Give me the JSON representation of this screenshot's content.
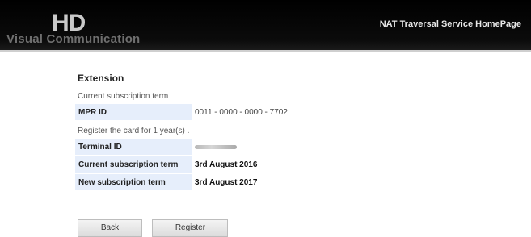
{
  "header": {
    "logo_mark": "HD",
    "logo_text": "Visual Communication",
    "nav_link": "NAT Traversal Service HomePage"
  },
  "page": {
    "title": "Extension",
    "current_term_note": "Current subscription term",
    "register_note": "Register the card for 1 year(s) ."
  },
  "mpr": {
    "label": "MPR ID",
    "value": "0011 - 0000 - 0000 - 7702"
  },
  "details": {
    "terminal_label": "Terminal ID",
    "current_label": "Current subscription term",
    "current_value": "3rd August 2016",
    "new_label": "New subscription term",
    "new_value": "3rd August 2017"
  },
  "buttons": {
    "back": "Back",
    "register": "Register"
  },
  "colors": {
    "header_bg": "#000000",
    "label_bg": "#e6eefb"
  }
}
